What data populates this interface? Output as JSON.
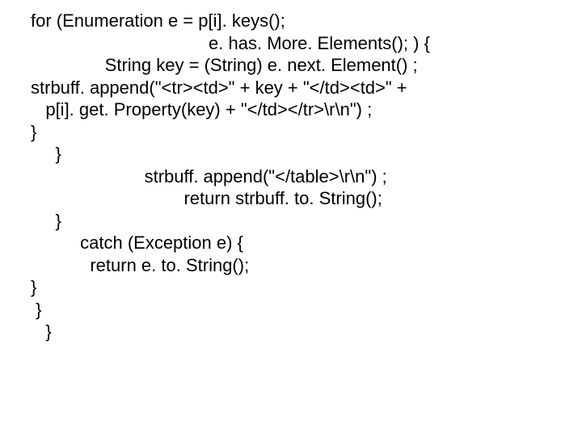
{
  "code": {
    "l1": "for (Enumeration e = p[i]. keys();",
    "l2": "                                    e. has. More. Elements(); ) {",
    "l3": "               String key = (String) e. next. Element() ;",
    "l4": "strbuff. append(\"<tr><td>\" + key + \"</td><td>\" +",
    "l5": "   p[i]. get. Property(key) + \"</td></tr>\\r\\n\") ;",
    "l6": "}",
    "l7": "     }",
    "l8": "                       strbuff. append(\"</table>\\r\\n\") ;",
    "l9": "                               return strbuff. to. String();",
    "l10": "     }",
    "l11": "          catch (Exception e) {",
    "l12": "            return e. to. String();",
    "l13": "}",
    "l14": " }",
    "l15": "   }"
  }
}
